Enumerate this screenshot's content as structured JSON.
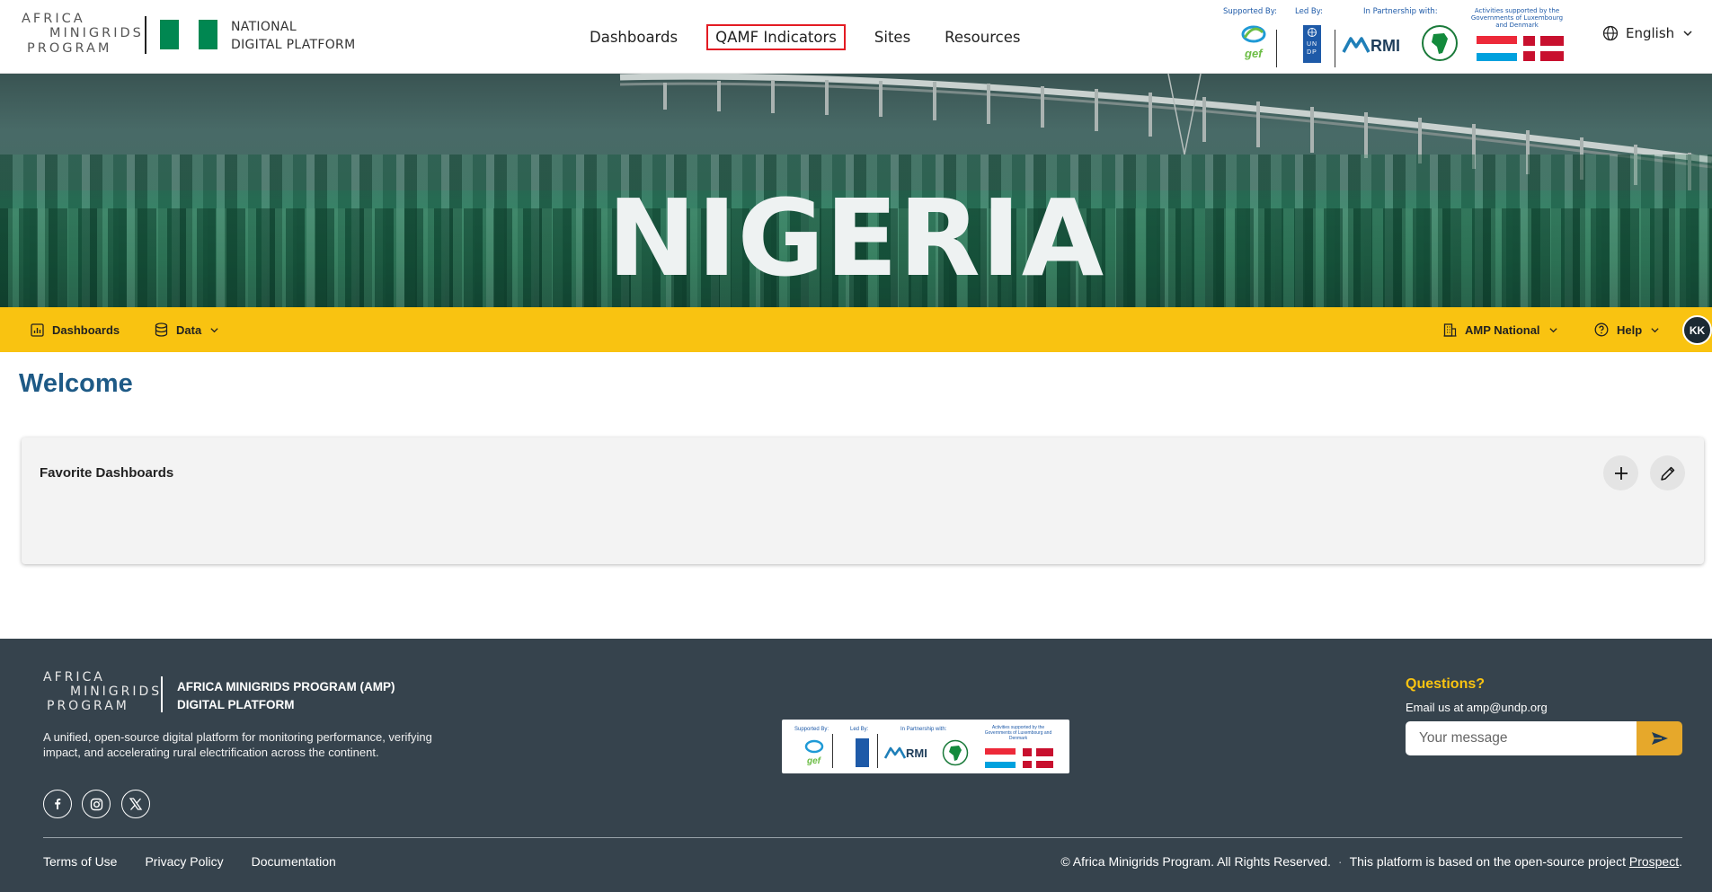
{
  "header": {
    "logo": {
      "line1": "AFRICA",
      "line2": "MINIGRIDS",
      "line3": "PROGRAM"
    },
    "platform_line1": "NATIONAL",
    "platform_line2": "DIGITAL PLATFORM",
    "flag_colors": [
      "#008751",
      "#ffffff",
      "#008751"
    ],
    "nav": [
      {
        "label": "Dashboards"
      },
      {
        "label": "QAMF Indicators"
      },
      {
        "label": "Sites"
      },
      {
        "label": "Resources"
      }
    ],
    "partners": {
      "supported_by": "Supported By:",
      "led_by": "Led By:",
      "partnership": "In Partnership with:",
      "activities": "Activities supported by the Governments of Luxembourg and Denmark",
      "gef": "gef",
      "undp": "U N D P",
      "rmi": "RMI"
    },
    "language": "English"
  },
  "hero": {
    "title": "NIGERIA"
  },
  "subnav": {
    "dashboards": "Dashboards",
    "data": "Data",
    "amp_national": "AMP National",
    "help": "Help",
    "avatar_initials": "KK",
    "background": "#f9c311"
  },
  "main": {
    "welcome": "Welcome",
    "favorites_title": "Favorite Dashboards"
  },
  "footer": {
    "logo": {
      "line1": "AFRICA",
      "line2": "MINIGRIDS",
      "line3": "PROGRAM"
    },
    "brand_line1": "AFRICA MINIGRIDS PROGRAM (AMP)",
    "brand_line2": "DIGITAL PLATFORM",
    "description": "A unified, open-source digital platform for monitoring performance, verifying impact, and accelerating rural electrification across the continent.",
    "partners": {
      "supported_by": "Supported By:",
      "led_by": "Led By:",
      "partnership": "In Partnership with:",
      "activities": "Activities supported by the Governments of Luxembourg and Denmark",
      "gef": "gef",
      "rmi": "RMI"
    },
    "questions": "Questions?",
    "email_text": "Email us at amp@undp.org",
    "message_placeholder": "Your message",
    "links": [
      {
        "label": "Terms of Use"
      },
      {
        "label": "Privacy Policy"
      },
      {
        "label": "Documentation"
      }
    ],
    "copyright": "© Africa Minigrids Program. All Rights Reserved.",
    "based_on": "This platform is based on the open-source project",
    "prospect_link": "Prospect",
    "period": ".",
    "background": "#36434d",
    "accent": "#f9c311"
  }
}
